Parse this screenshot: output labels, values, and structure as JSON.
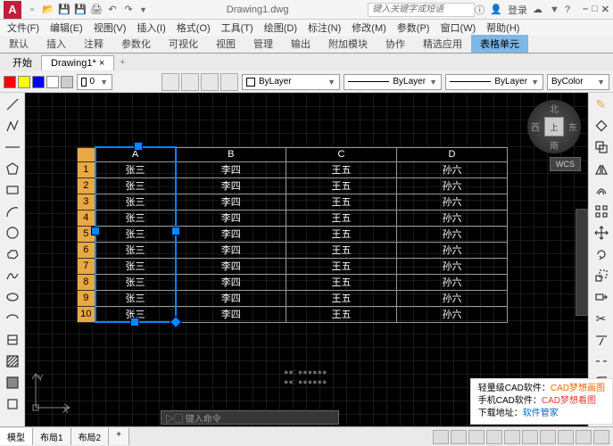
{
  "title": "Drawing1.dwg",
  "search_placeholder": "键入关键字或短语",
  "login": "登录",
  "menubar": [
    "文件(F)",
    "编辑(E)",
    "视图(V)",
    "插入(I)",
    "格式(O)",
    "工具(T)",
    "绘图(D)",
    "标注(N)",
    "修改(M)",
    "参数(P)",
    "窗口(W)",
    "帮助(H)"
  ],
  "ribbon_tabs": [
    "默认",
    "插入",
    "注释",
    "参数化",
    "可视化",
    "视图",
    "管理",
    "输出",
    "附加模块",
    "协作",
    "精选应用",
    "表格单元"
  ],
  "start_tab": "开始",
  "doc_tab": "Drawing1*",
  "bylayer": "ByLayer",
  "bycolor": "ByColor",
  "compass": {
    "n": "北",
    "s": "南",
    "e": "东",
    "w": "西",
    "top": "上"
  },
  "wcs": "WCS",
  "table": {
    "cols": [
      "",
      "A",
      "B",
      "C",
      "D"
    ],
    "rows": [
      {
        "n": "1",
        "a": "张三",
        "b": "李四",
        "c": "王五",
        "d": "孙六"
      },
      {
        "n": "2",
        "a": "张三",
        "b": "李四",
        "c": "王五",
        "d": "孙六"
      },
      {
        "n": "3",
        "a": "张三",
        "b": "李四",
        "c": "王五",
        "d": "孙六"
      },
      {
        "n": "4",
        "a": "张三",
        "b": "李四",
        "c": "王五",
        "d": "孙六"
      },
      {
        "n": "5",
        "a": "张三",
        "b": "李四",
        "c": "王五",
        "d": "孙六"
      },
      {
        "n": "6",
        "a": "张三",
        "b": "李四",
        "c": "王五",
        "d": "孙六"
      },
      {
        "n": "7",
        "a": "张三",
        "b": "李四",
        "c": "王五",
        "d": "孙六"
      },
      {
        "n": "8",
        "a": "张三",
        "b": "李四",
        "c": "王五",
        "d": "孙六"
      },
      {
        "n": "9",
        "a": "张三",
        "b": "李四",
        "c": "王五",
        "d": "孙六"
      },
      {
        "n": "10",
        "a": "张三",
        "b": "李四",
        "c": "王五",
        "d": "孙六"
      }
    ]
  },
  "axis_x": "X",
  "axis_y": "Y",
  "model_tabs": [
    "模型",
    "布局1",
    "布局2"
  ],
  "cmd_prompt": "▷▢ 键入命令",
  "cmd_hint1": "●●: ●●●●●●",
  "cmd_hint2": "●●: ●●●●●●",
  "watermark": {
    "l1a": "轻量级CAD软件：",
    "l1b": "CAD梦想画图",
    "l2a": "手机CAD软件：",
    "l2b": "CAD梦想看图",
    "l3a": "下载地址：",
    "l3b": "软件管家"
  },
  "color_index": "0"
}
